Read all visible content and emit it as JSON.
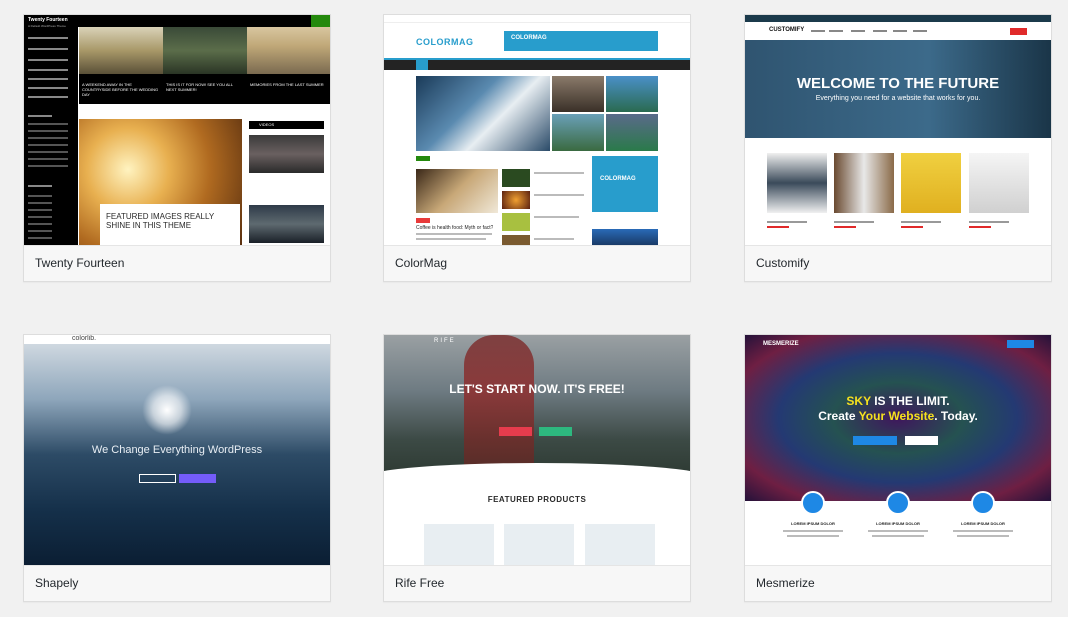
{
  "themes": [
    {
      "name": "Twenty Fourteen",
      "preview": {
        "site_title": "Twenty Fourteen",
        "tagline": "A Default WordPress Theme",
        "tiles": [
          "A WEEKEND AWAY IN THE COUNTRYSIDE BEFORE THE WEDDING DAY",
          "THIS IS IT FOR NOW! SEE YOU ALL NEXT SUMMER!",
          "MEMORIES FROM THE LAST SUMMER"
        ],
        "featured_title": "FEATURED IMAGES REALLY SHINE IN THIS THEME",
        "widget": "VIDEOS",
        "accent": "#24890d"
      }
    },
    {
      "name": "ColorMag",
      "preview": {
        "logo": "COLORMAG",
        "ad_text": "COLORMAG",
        "box_text": "COLORMAG",
        "accent": "#289dcc",
        "headline": "Coffee is health food: Myth or fact?"
      }
    },
    {
      "name": "Customify",
      "preview": {
        "logo": "CUSTOMIFY",
        "hero_title": "WELCOME TO THE FUTURE",
        "hero_sub": "Everything you need for a website that works for you.",
        "accent": "#e02a2a"
      }
    },
    {
      "name": "Shapely",
      "preview": {
        "logo": "colorlib.",
        "hero_title": "We Change Everything WordPress",
        "accent": "#745cf9"
      }
    },
    {
      "name": "Rife Free",
      "preview": {
        "logo": "RIFE",
        "hero_title": "LET'S START NOW. IT'S FREE!",
        "section_title": "FEATURED PRODUCTS",
        "accent": "#e63c4d"
      }
    },
    {
      "name": "Mesmerize",
      "preview": {
        "logo": "MESMERIZE",
        "hero_line1_a": "SKY",
        "hero_line1_b": " IS THE LIMIT.",
        "hero_line2_a": "Create ",
        "hero_line2_b": "Your Website",
        "hero_line2_c": ". Today.",
        "feature_titles": [
          "LOREM IPSUM DOLOR",
          "LOREM IPSUM DOLOR",
          "LOREM IPSUM DOLOR"
        ],
        "accent": "#1e88e5",
        "highlight": "#f5e11e"
      }
    }
  ]
}
